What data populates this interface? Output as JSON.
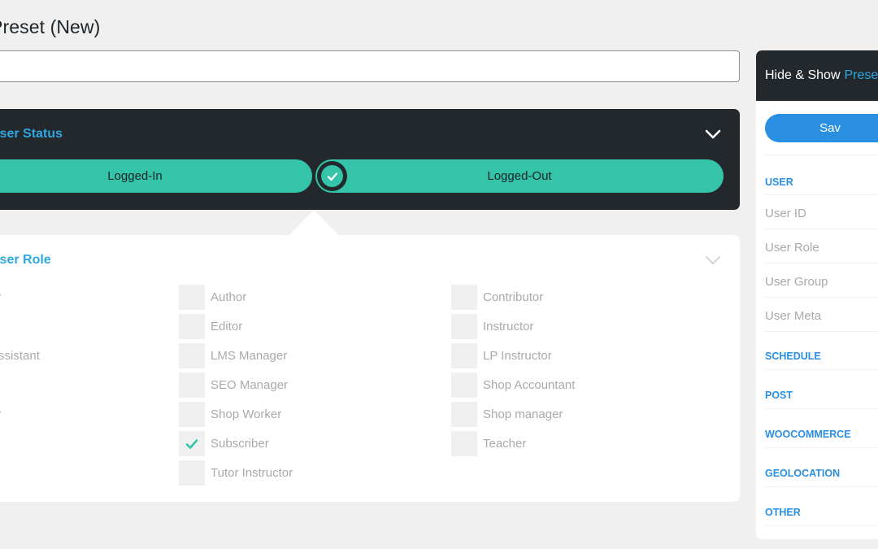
{
  "page": {
    "title": "Preset (New)"
  },
  "name_input": {
    "value": ""
  },
  "status_panel": {
    "title": "User Status",
    "options": [
      {
        "label": "Logged-In",
        "checked": false
      },
      {
        "label": "Logged-Out",
        "checked": true
      }
    ]
  },
  "role_panel": {
    "title": "User Role",
    "partial_labels": [
      "or",
      "Assistant",
      "or"
    ],
    "col2": [
      {
        "label": "Author",
        "checked": false
      },
      {
        "label": "Editor",
        "checked": false
      },
      {
        "label": "LMS Manager",
        "checked": false
      },
      {
        "label": "SEO Manager",
        "checked": false
      },
      {
        "label": "Shop Worker",
        "checked": false
      },
      {
        "label": "Subscriber",
        "checked": true
      },
      {
        "label": "Tutor Instructor",
        "checked": false
      }
    ],
    "col3": [
      {
        "label": "Contributor",
        "checked": false
      },
      {
        "label": "Instructor",
        "checked": false
      },
      {
        "label": "LP Instructor",
        "checked": false
      },
      {
        "label": "Shop Accountant",
        "checked": false
      },
      {
        "label": "Shop manager",
        "checked": false
      },
      {
        "label": "Teacher",
        "checked": false
      }
    ]
  },
  "sidebar": {
    "title": "Hide & Show",
    "title_accent": "Prese",
    "save_label": "Sav",
    "sections": {
      "user": "USER",
      "user_items": [
        "User ID",
        "User Role",
        "User Group",
        "User Meta"
      ],
      "schedule": "SCHEDULE",
      "post": "POST",
      "woocommerce": "WOOCOMMERCE",
      "geolocation": "GEOLOCATION",
      "other": "OTHER"
    }
  },
  "colors": {
    "accent_blue": "#2ea8e0",
    "teal": "#33c4a9",
    "dark_panel": "#23282d"
  }
}
